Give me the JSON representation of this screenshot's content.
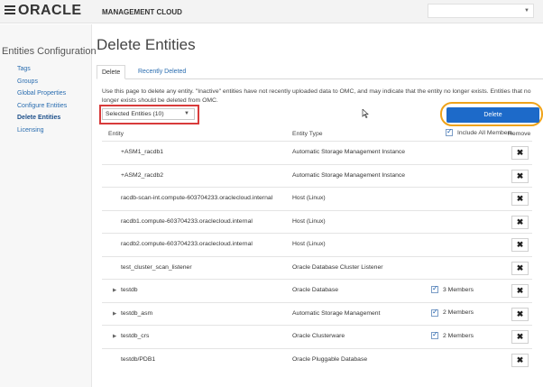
{
  "header": {
    "logo": "ORACLE",
    "product": "MANAGEMENT CLOUD",
    "select_value": ""
  },
  "sidebar": {
    "title": "Entities Configuration",
    "items": [
      {
        "label": "Tags"
      },
      {
        "label": "Groups"
      },
      {
        "label": "Global Properties"
      },
      {
        "label": "Configure Entities"
      },
      {
        "label": "Delete Entities",
        "active": true
      },
      {
        "label": "Licensing"
      }
    ]
  },
  "main": {
    "title": "Delete Entities",
    "tabs": [
      {
        "label": "Delete",
        "active": true
      },
      {
        "label": "Recently Deleted"
      }
    ],
    "description": "Use this page to delete any entity. \"Inactive\" entities have not recently uploaded data to OMC, and may indicate that the entity no longer exists. Entities that no longer exists should be deleted from OMC.",
    "select_value": "Selected Entities (10)",
    "delete_label": "Delete"
  },
  "table": {
    "headers": {
      "entity": "Entity",
      "type": "Entity Type",
      "include": "Include All Members",
      "remove": "Remove"
    },
    "rows": [
      {
        "entity": "+ASM1_racdb1",
        "type": "Automatic Storage Management Instance",
        "expandable": false,
        "members": ""
      },
      {
        "entity": "+ASM2_racdb2",
        "type": "Automatic Storage Management Instance",
        "expandable": false,
        "members": ""
      },
      {
        "entity": "racdb-scan-int.compute-603704233.oraclecloud.internal",
        "type": "Host (Linux)",
        "expandable": false,
        "members": ""
      },
      {
        "entity": "racdb1.compute-603704233.oraclecloud.internal",
        "type": "Host (Linux)",
        "expandable": false,
        "members": ""
      },
      {
        "entity": "racdb2.compute-603704233.oraclecloud.internal",
        "type": "Host (Linux)",
        "expandable": false,
        "members": ""
      },
      {
        "entity": "test_cluster_scan_listener",
        "type": "Oracle Database Cluster Listener",
        "expandable": false,
        "members": ""
      },
      {
        "entity": "testdb",
        "type": "Oracle Database",
        "expandable": true,
        "members": "3 Members"
      },
      {
        "entity": "testdb_asm",
        "type": "Automatic Storage Management",
        "expandable": true,
        "members": "2 Members"
      },
      {
        "entity": "testdb_crs",
        "type": "Oracle Clusterware",
        "expandable": true,
        "members": "2 Members"
      },
      {
        "entity": "testdb/PDB1",
        "type": "Oracle Pluggable Database",
        "expandable": false,
        "members": ""
      }
    ]
  },
  "icons": {
    "remove": "close-icon",
    "expander": "expand-triangle-icon",
    "menu": "hamburger-menu-icon"
  },
  "colors": {
    "accent": "#1d6ac9",
    "link": "#2a6db0",
    "highlight_red": "#d83b3b",
    "highlight_orange": "#efa31a"
  }
}
